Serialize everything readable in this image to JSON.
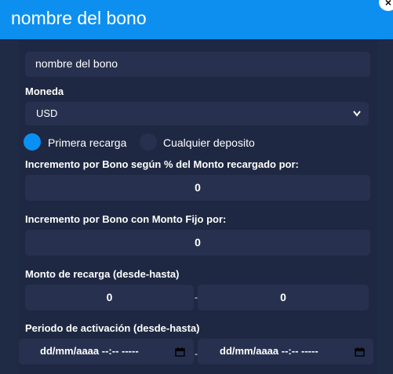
{
  "header": {
    "title": "nombre del bono",
    "close_label": "×"
  },
  "form": {
    "name_input": {
      "value": "nombre del bono"
    },
    "currency": {
      "label": "Moneda",
      "selected": "USD",
      "chevron": "chevron-down-icon"
    },
    "radios": {
      "primera": {
        "label": "Primera recarga",
        "checked": true
      },
      "cualquier": {
        "label": "Cualquier deposito",
        "checked": false
      }
    },
    "percent_bonus": {
      "label": "Incremento por Bono según % del Monto recargado por:",
      "value": "0"
    },
    "fixed_bonus": {
      "label": "Incremento por Bono con Monto Fijo por:",
      "value": "0"
    },
    "recharge_range": {
      "label": "Monto de recarga (desde-hasta)",
      "from": "0",
      "to": "0",
      "separator": "-"
    },
    "activation_period": {
      "label": "Periodo de activación (desde-hasta)",
      "from_placeholder": "dd/mm/aaaa --:-- -----",
      "to_placeholder": "dd/mm/aaaa --:-- -----",
      "separator": "-"
    }
  },
  "colors": {
    "accent": "#0d8ff0",
    "background": "#1f2a44",
    "field": "#27314f"
  }
}
